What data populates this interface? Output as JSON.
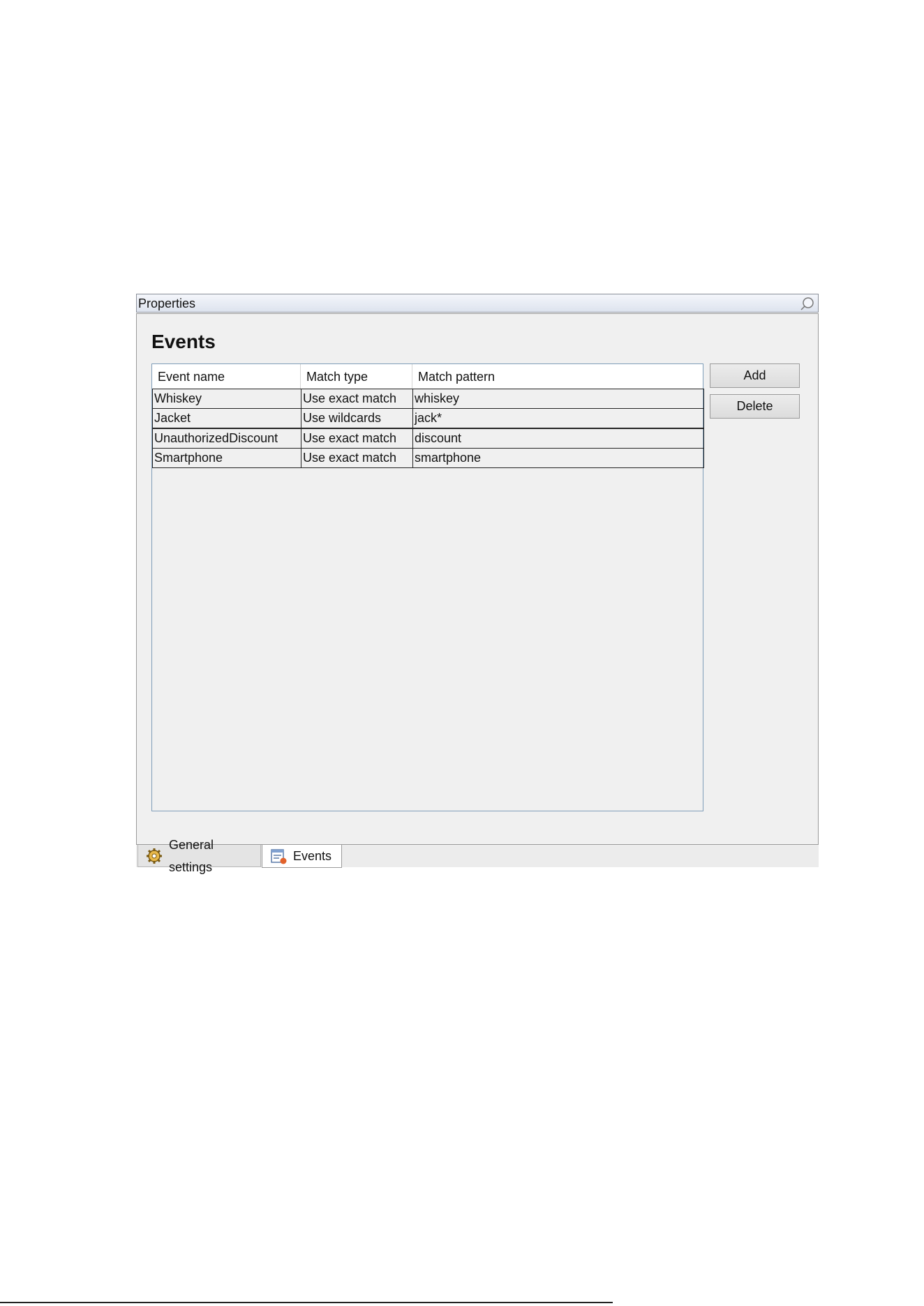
{
  "window": {
    "title": "Properties",
    "pin_icon": "pin-icon"
  },
  "events_page": {
    "heading": "Events",
    "columns": [
      "Event name",
      "Match type",
      "Match pattern"
    ],
    "rows": [
      {
        "event_name": "Whiskey",
        "match_type": "Use exact match",
        "match_pattern": "whiskey"
      },
      {
        "event_name": "Jacket",
        "match_type": "Use wildcards",
        "match_pattern": "jack*"
      },
      {
        "event_name": "UnauthorizedDiscount",
        "match_type": "Use exact match",
        "match_pattern": "discount"
      },
      {
        "event_name": "Smartphone",
        "match_type": "Use exact match",
        "match_pattern": "smartphone"
      }
    ],
    "add_label": "Add",
    "delete_label": "Delete"
  },
  "tabs": [
    {
      "label": "General settings",
      "icon": "gear-icon",
      "active": false
    },
    {
      "label": "Events",
      "icon": "events-list-icon",
      "active": true
    }
  ]
}
